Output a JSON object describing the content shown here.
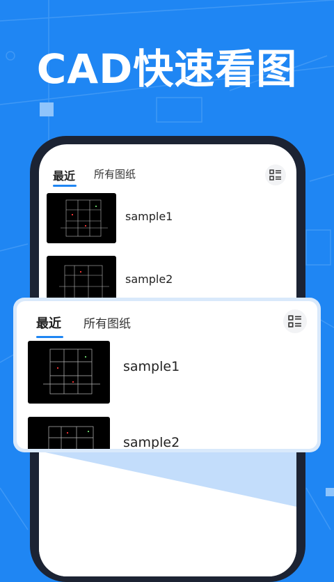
{
  "headline": "CAD快速看图",
  "colors": {
    "brand_blue": "#1f86f3",
    "phone_frame": "#1c2333",
    "card_border": "#d9e9fb"
  },
  "tabs": [
    {
      "label": "最近",
      "active": true
    },
    {
      "label": "所有图纸",
      "active": false
    }
  ],
  "view_toggle_icon": "list-view-icon",
  "files": [
    {
      "name": "sample1",
      "thumbnail_icon": "cad-drawing-thumbnail"
    },
    {
      "name": "sample2",
      "thumbnail_icon": "cad-drawing-thumbnail"
    }
  ],
  "zoom_card": {
    "tabs": [
      {
        "label": "最近",
        "active": true
      },
      {
        "label": "所有图纸",
        "active": false
      }
    ],
    "files": [
      {
        "name": "sample1"
      },
      {
        "name": "sample2"
      }
    ]
  }
}
